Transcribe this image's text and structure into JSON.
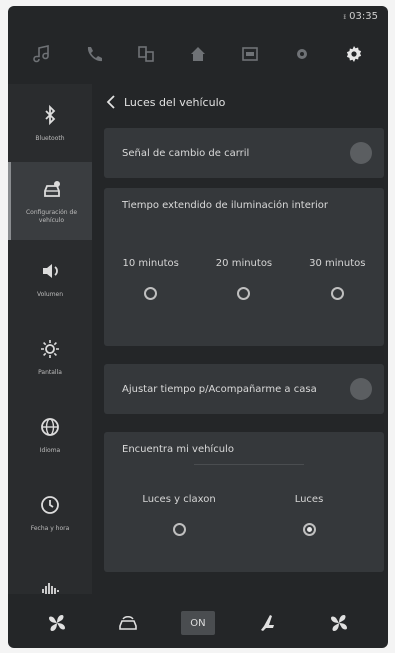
{
  "status": {
    "time": "03:35"
  },
  "topnav": {
    "items": [
      {
        "icon": "music-note-icon"
      },
      {
        "icon": "phone-icon"
      },
      {
        "icon": "apps-icon"
      },
      {
        "icon": "home-icon"
      },
      {
        "icon": "vehicle-info-icon"
      },
      {
        "icon": "gear-small-icon"
      },
      {
        "icon": "settings-gear-icon",
        "active": true
      }
    ]
  },
  "sidebar": {
    "items": [
      {
        "label": "Bluetooth",
        "icon": "bluetooth-icon"
      },
      {
        "label": "Configuración de vehículo",
        "icon": "car-settings-icon",
        "active": true
      },
      {
        "label": "Volumen",
        "icon": "speaker-icon"
      },
      {
        "label": "Pantalla",
        "icon": "brightness-icon"
      },
      {
        "label": "Idioma",
        "icon": "globe-icon"
      },
      {
        "label": "Fecha y hora",
        "icon": "clock-icon"
      },
      {
        "label": "",
        "icon": "sound-wave-icon"
      }
    ]
  },
  "main": {
    "back_title": "Luces del vehículo",
    "lane_change_label": "Señal de cambio de carril",
    "interior": {
      "title": "Tiempo extendido de iluminación interior",
      "options": [
        "10 minutos",
        "20 minutos",
        "30 minutos"
      ]
    },
    "follow_me_label": "Ajustar tiempo p/Acompañarme a casa",
    "find_vehicle": {
      "title": "Encuentra mi vehículo",
      "options": [
        {
          "label": "Luces y claxon",
          "selected": false
        },
        {
          "label": "Luces",
          "selected": true
        }
      ]
    }
  },
  "bottombar": {
    "on_label": "ON",
    "items": [
      "fan-left-icon",
      "climate-car-icon",
      "on-button",
      "seat-icon",
      "fan-right-icon"
    ]
  },
  "colors": {
    "background": "#242628",
    "card": "#35383b",
    "sidebar_active": "#3a3d40"
  }
}
